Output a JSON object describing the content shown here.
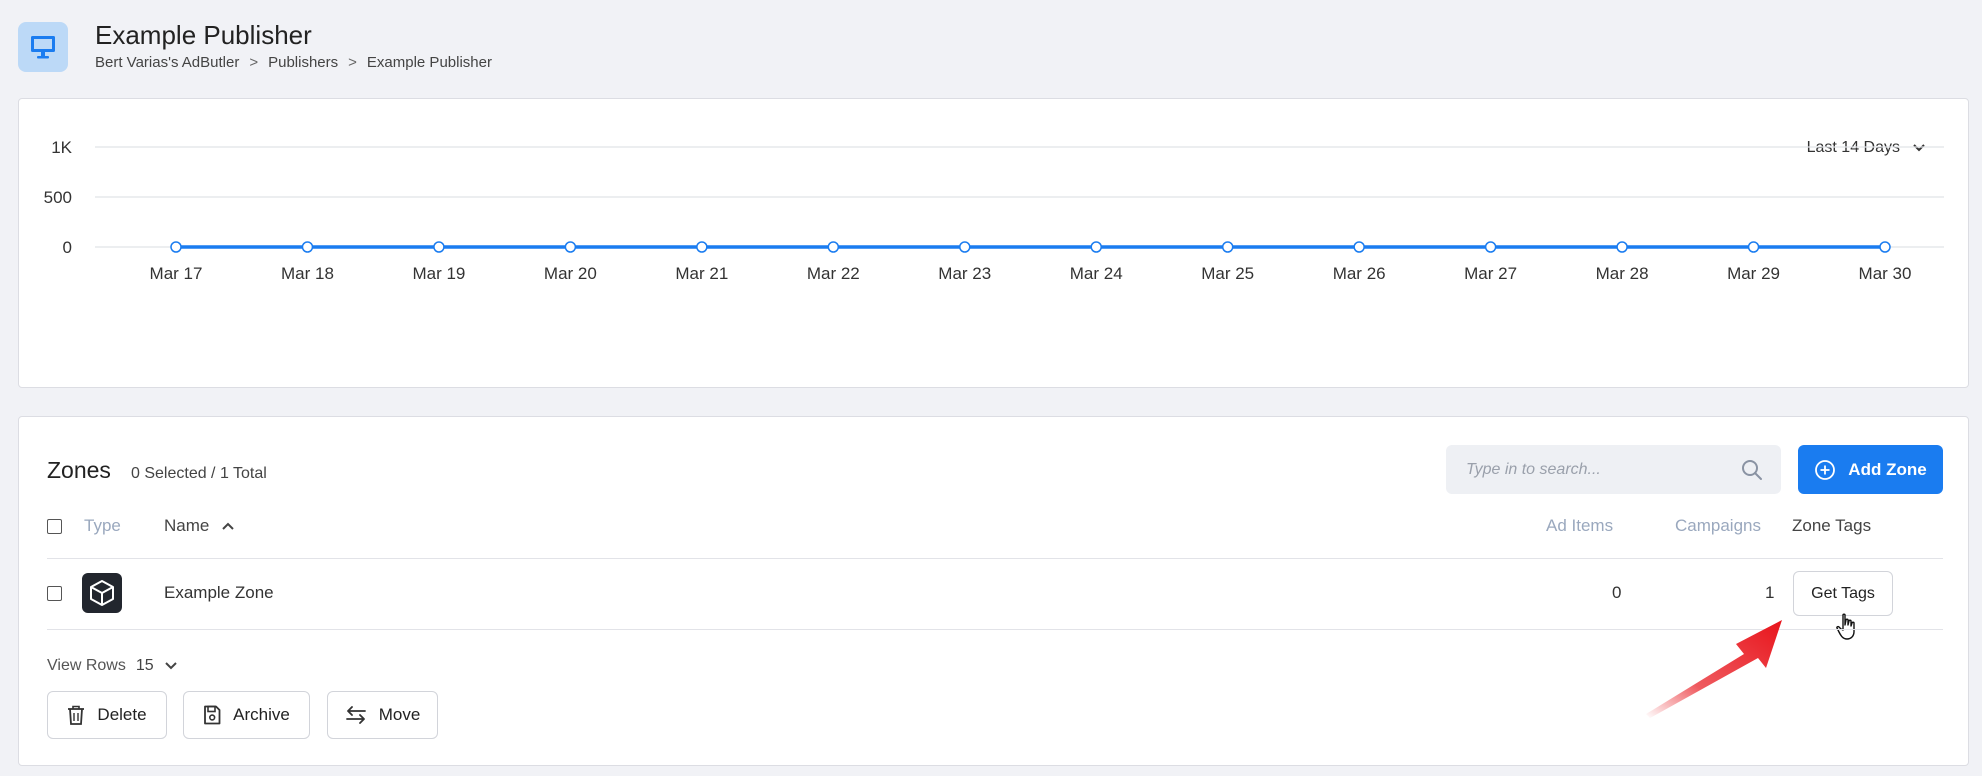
{
  "header": {
    "title": "Example Publisher",
    "breadcrumb": [
      "Bert Varias's AdButler",
      "Publishers",
      "Example Publisher"
    ],
    "breadcrumb_separator": ">",
    "icon": "monitor-icon"
  },
  "chart_controls": {
    "range_label": "Last 14 Days"
  },
  "chart_data": {
    "type": "line",
    "categories": [
      "Mar 17",
      "Mar 18",
      "Mar 19",
      "Mar 20",
      "Mar 21",
      "Mar 22",
      "Mar 23",
      "Mar 24",
      "Mar 25",
      "Mar 26",
      "Mar 27",
      "Mar 28",
      "Mar 29",
      "Mar 30"
    ],
    "series": [
      {
        "values": [
          0,
          0,
          0,
          0,
          0,
          0,
          0,
          0,
          0,
          0,
          0,
          0,
          0,
          0
        ],
        "color": "#1a7cf0"
      }
    ],
    "yticks": [
      "0",
      "500",
      "1K"
    ],
    "ylim": [
      0,
      1000
    ],
    "grid": true,
    "title": "",
    "xlabel": "",
    "ylabel": ""
  },
  "zones": {
    "title": "Zones",
    "selection_summary": "0 Selected / 1 Total",
    "search_placeholder": "Type in to search...",
    "add_button_label": "Add Zone",
    "columns": {
      "type": "Type",
      "name": "Name",
      "ad_items": "Ad Items",
      "campaigns": "Campaigns",
      "zone_tags": "Zone Tags"
    },
    "rows": [
      {
        "type_icon": "cube-icon",
        "name": "Example Zone",
        "ad_items": "0",
        "campaigns": "1",
        "tags_button": "Get Tags"
      }
    ],
    "view_rows_label": "View Rows",
    "view_rows_value": "15",
    "actions": {
      "delete": "Delete",
      "archive": "Archive",
      "move": "Move"
    }
  },
  "colors": {
    "accent": "#1a7cf0",
    "background": "#f1f2f6",
    "annotation_arrow": "#e8141b"
  }
}
